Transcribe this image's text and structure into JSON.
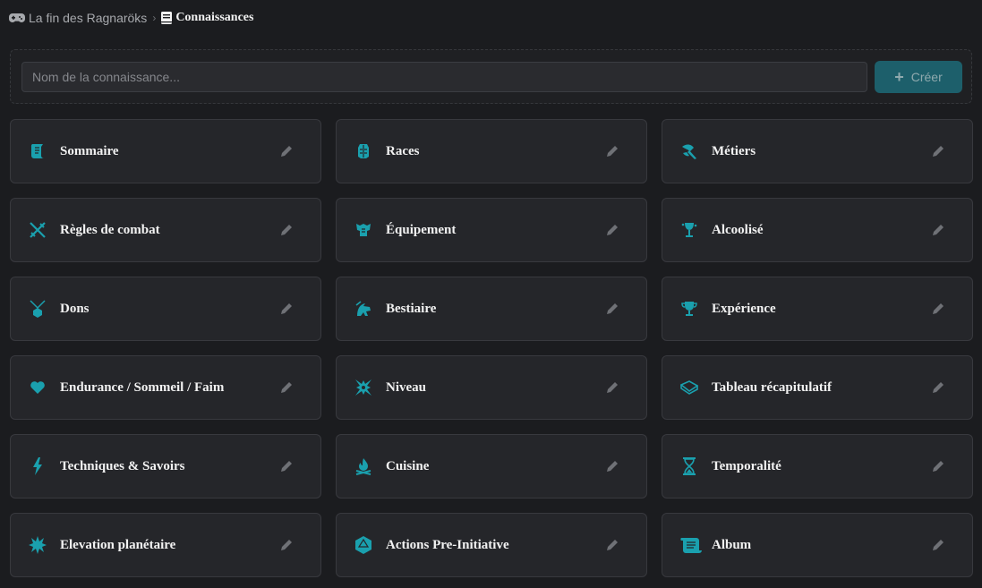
{
  "breadcrumb": {
    "parent_label": "La fin des Ragnaröks",
    "parent_icon": "gamepad-icon",
    "current_label": "Connaissances",
    "current_icon": "book-icon"
  },
  "create": {
    "placeholder": "Nom de la connaissance...",
    "button_label": "Créer",
    "button_icon": "plus-icon"
  },
  "accent_color": "#1aa0ae",
  "cards": [
    {
      "label": "Sommaire",
      "icon": "scroll-icon"
    },
    {
      "label": "Races",
      "icon": "torso-icon"
    },
    {
      "label": "Métiers",
      "icon": "axe-icon"
    },
    {
      "label": "Règles de combat",
      "icon": "crossed-swords-icon"
    },
    {
      "label": "Équipement",
      "icon": "armor-icon"
    },
    {
      "label": "Alcoolisé",
      "icon": "goblet-icon"
    },
    {
      "label": "Dons",
      "icon": "dice-pendant-icon"
    },
    {
      "label": "Bestiaire",
      "icon": "dragon-head-icon"
    },
    {
      "label": "Expérience",
      "icon": "trophy-icon"
    },
    {
      "label": "Endurance / Sommeil / Faim",
      "icon": "heart-icon"
    },
    {
      "label": "Niveau",
      "icon": "level-star-icon"
    },
    {
      "label": "Tableau récapitulatif",
      "icon": "open-book-icon"
    },
    {
      "label": "Techniques & Savoirs",
      "icon": "lightning-icon"
    },
    {
      "label": "Cuisine",
      "icon": "campfire-icon"
    },
    {
      "label": "Temporalité",
      "icon": "hourglass-icon"
    },
    {
      "label": "Elevation planétaire",
      "icon": "starburst-icon"
    },
    {
      "label": "Actions Pre-Initiative",
      "icon": "d20-icon"
    },
    {
      "label": "Album",
      "icon": "parchment-icon"
    }
  ],
  "edit_icon": "pencil-icon"
}
